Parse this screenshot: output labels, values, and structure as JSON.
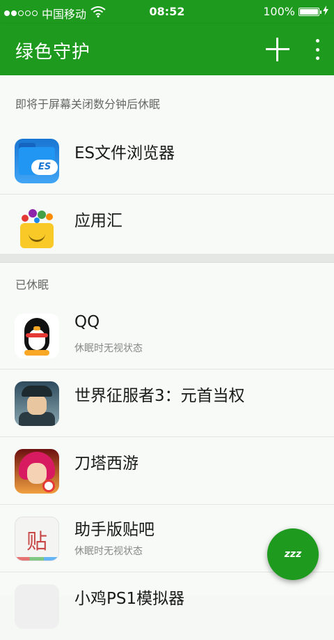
{
  "status_bar": {
    "carrier": "中国移动",
    "time": "08:52",
    "battery": "100%",
    "signal_strength": 2,
    "signal_max": 5,
    "icons": [
      "signal-dots-icon",
      "wifi-icon",
      "battery-icon",
      "charging-icon"
    ]
  },
  "app_bar": {
    "title": "绿色守护",
    "add_icon": "plus-icon",
    "more_icon": "more-vert-icon"
  },
  "sections": {
    "pending": {
      "header": "即将于屏幕关闭数分钟后休眠",
      "apps": [
        {
          "name": "ES文件浏览器",
          "subtitle": ""
        },
        {
          "name": "应用汇",
          "subtitle": ""
        }
      ]
    },
    "hibernated": {
      "header": "已休眠",
      "apps": [
        {
          "name": "QQ",
          "subtitle": "休眠时无视状态"
        },
        {
          "name": "世界征服者3：元首当权",
          "subtitle": ""
        },
        {
          "name": "刀塔西游",
          "subtitle": ""
        },
        {
          "name": "助手版贴吧",
          "subtitle": "休眠时无视状态"
        },
        {
          "name": "小鸡PS1模拟器",
          "subtitle": ""
        }
      ]
    }
  },
  "icon_text": {
    "tieba": "贴",
    "es": "ES"
  },
  "fab": {
    "icon": "sleep-zzz-icon",
    "text": "zzz"
  },
  "colors": {
    "primary": "#1e9a1e",
    "background": "#f5f8f5"
  }
}
